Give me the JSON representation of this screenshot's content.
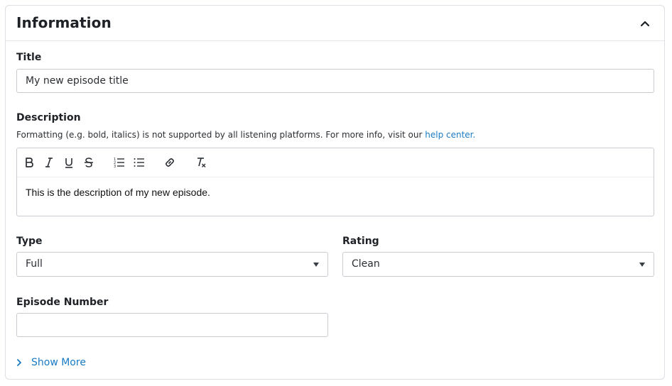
{
  "section": {
    "title": "Information",
    "collapse_icon": "chevron-up-icon"
  },
  "fields": {
    "title": {
      "label": "Title",
      "value": "My new episode title"
    },
    "description": {
      "label": "Description",
      "hint_text": "Formatting (e.g. bold, italics) is not supported by all listening platforms. For more info, visit our ",
      "hint_link": "help center.",
      "content": "This is the description of my new episode.",
      "toolbar": [
        "bold-icon",
        "italic-icon",
        "underline-icon",
        "strikethrough-icon",
        "ordered-list-icon",
        "bullet-list-icon",
        "link-icon",
        "clear-format-icon"
      ]
    },
    "type": {
      "label": "Type",
      "value": "Full"
    },
    "rating": {
      "label": "Rating",
      "value": "Clean"
    },
    "episode_number": {
      "label": "Episode Number",
      "value": ""
    }
  },
  "show_more": {
    "label": "Show More"
  },
  "colors": {
    "link": "#1a7bc4",
    "border": "#c8ccd1",
    "text": "#1e2125"
  }
}
